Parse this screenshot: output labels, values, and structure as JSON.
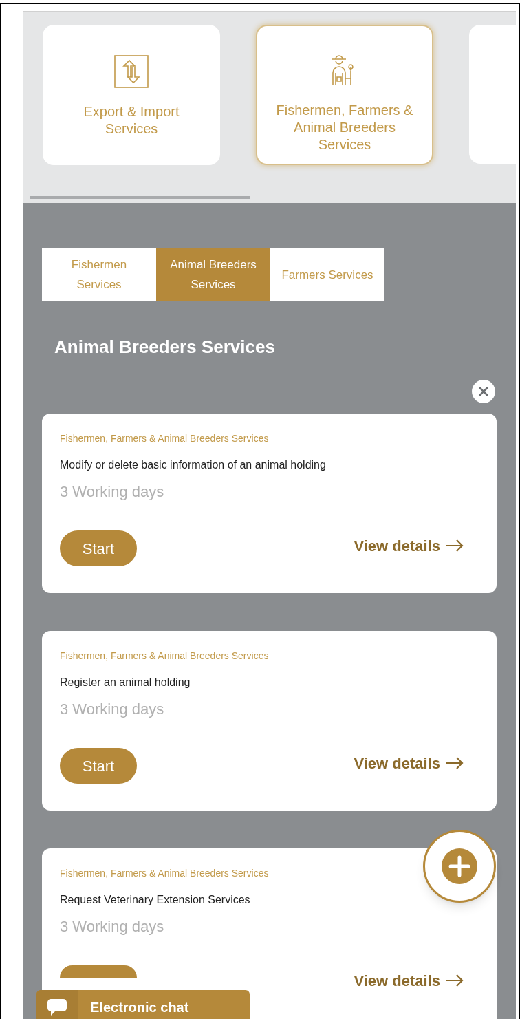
{
  "categories": [
    {
      "label": "Export & Import Services",
      "selected": false
    },
    {
      "label": "Fishermen, Farmers & Animal Breeders Services",
      "selected": true
    },
    {
      "selected": false
    }
  ],
  "tabs": [
    {
      "label": "Fishermen Services",
      "selected": false
    },
    {
      "label": "Animal Breeders Services",
      "selected": true
    },
    {
      "label": "Farmers Services",
      "selected": false
    }
  ],
  "heading": "Animal Breeders Services",
  "services": [
    {
      "category": "Fishermen, Farmers & Animal Breeders Services",
      "title": "Modify or delete basic information of an animal holding",
      "duration": "3 Working days",
      "start": "Start",
      "details": "View details"
    },
    {
      "category": "Fishermen, Farmers & Animal Breeders Services",
      "title": "Register an animal holding",
      "duration": "3 Working days",
      "start": "Start",
      "details": "View details"
    },
    {
      "category": "Fishermen, Farmers & Animal Breeders Services",
      "title": "Request Veterinary Extension Services",
      "duration": "3 Working days",
      "details": "View details"
    }
  ],
  "chat": {
    "label": "Electronic chat"
  }
}
